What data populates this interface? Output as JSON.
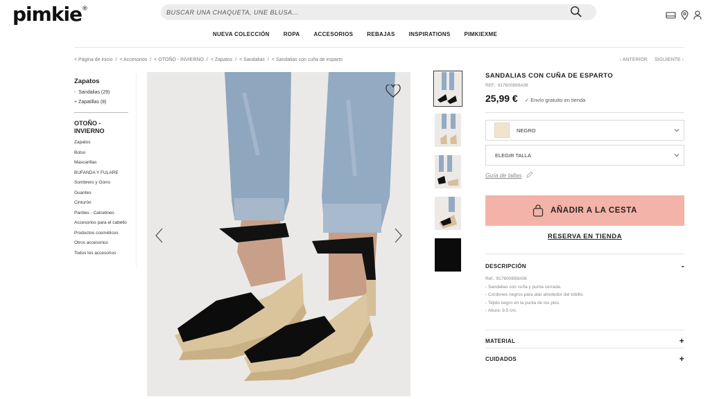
{
  "header": {
    "logo": "pimkie",
    "logo_mark": "®",
    "search_placeholder": "BUSCAR UNA CHAQUETA, UNE BLUSA..."
  },
  "nav": [
    "NUEVA COLECCIÓN",
    "ROPA",
    "ACCESORIOS",
    "REBAJAS",
    "INSPIRATIONS",
    "PIMKIEXME"
  ],
  "breadcrumb": [
    "< Página de inicio",
    "/",
    "< Accesorios",
    "/",
    "< OTOÑO - INVIERNO",
    "/",
    "< Zapatos",
    "/",
    "< Sandalias",
    "/",
    "< Sandalias con cuña de esparto"
  ],
  "pager": {
    "prev": "ANTERIOR",
    "next": "SIGUIENTE"
  },
  "sidebar": {
    "heading": "Zapatos",
    "sub": [
      {
        "label": "Sandalias (29)",
        "prefix": "-"
      },
      {
        "label": "Zapatillas (8)",
        "prefix": "+"
      }
    ],
    "heading2": "OTOÑO - INVIERNO",
    "items": [
      "Zapatos",
      "Bolso",
      "Mascarillas",
      "BUFANDA Y FULARE",
      "Sombrero y Gorro",
      "Guantes",
      "Cinturón",
      "Panties - Calcetines",
      "Accesorios para el cabello",
      "Productos cosméticos",
      "Otros accesorios",
      "Todos los accesorios"
    ]
  },
  "product": {
    "title": "SANDALIAS CON CUÑA DE ESPARTO",
    "ref": "REF.: 917600899A08",
    "price": "25,99 €",
    "shipping": "✓ Envío gratuito en tienda",
    "color": "NEGRO",
    "size_select": "ELEGIR TALLA",
    "size_guide": "Guía de tallas",
    "add_to_cart": "AÑADIR A LA CESTA",
    "reserve": "RESERVA EN TIENDA",
    "swatch_color": "#f1e4cf",
    "button_color": "#f4b3a8"
  },
  "accordion": {
    "description": {
      "title": "DESCRIPCIÓN",
      "sign": "-",
      "lines": [
        "Ref.: 917600899A08",
        "- Sandalias con cuña y punta cerrada.",
        "- Cordones negros para atar alrededor del tobillo.",
        "- Tejido negro en la punta de los pies.",
        "- Altura: 9,5 cm."
      ]
    },
    "material": {
      "title": "MATERIAL",
      "sign": "+"
    },
    "care": {
      "title": "CUIDADOS",
      "sign": "+"
    }
  },
  "icons": [
    "search-icon",
    "card-icon",
    "location-icon",
    "user-icon",
    "heart-icon",
    "chevron-left-icon",
    "chevron-right-icon",
    "bag-icon",
    "pencil-icon",
    "chevron-down-icon"
  ]
}
